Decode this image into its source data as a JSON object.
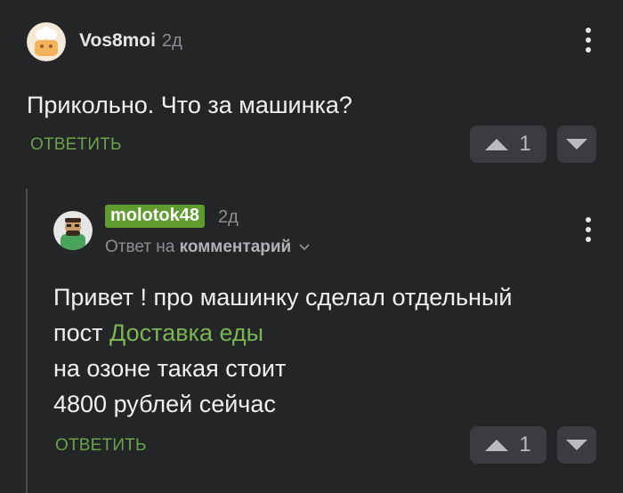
{
  "comment1": {
    "username": "Vos8moi",
    "time": "2д",
    "text": "Прикольно. Что за машинка?",
    "reply_label": "ОТВЕТИТЬ",
    "votes": "1"
  },
  "comment2": {
    "username": "molotok48",
    "time": "2д",
    "reply_prefix": "Ответ на",
    "reply_target": "комментарий",
    "text_line1": "Привет ! про машинку сделал отдельный",
    "text_line2_prefix": "пост",
    "text_link": "Доставка еды",
    "text_line3": "на озоне такая стоит",
    "text_line4": "4800 рублей сейчас",
    "reply_label": "ОТВЕТИТЬ",
    "votes": "1"
  },
  "icons": {
    "more": "more-vertical-icon",
    "upvote": "triangle-up-icon",
    "downvote": "triangle-down-icon",
    "chevron": "chevron-down-icon"
  },
  "colors": {
    "background": "#232527",
    "accent_green": "#68a34a",
    "tag_green": "#5f9b2e"
  }
}
